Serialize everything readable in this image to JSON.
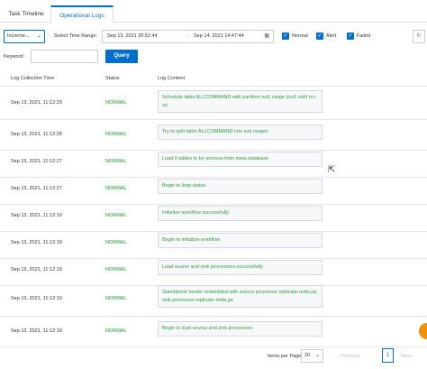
{
  "tabs": [
    {
      "label": "Task Timeline"
    },
    {
      "label": "Operational Logs"
    }
  ],
  "filters": {
    "level_select": "Increme...",
    "time_range_label": "Select Time Range:",
    "time_start": "Sep 13, 2021 20:52:44",
    "time_separator": "-",
    "time_end": "Sep 14, 2021 14:47:44",
    "checkboxes": [
      {
        "label": "Normal",
        "checked": true
      },
      {
        "label": "Alert",
        "checked": true
      },
      {
        "label": "Failed",
        "checked": true
      }
    ]
  },
  "search": {
    "keyword_label": "Keyword:",
    "keyword_value": "",
    "query_label": "Query"
  },
  "table": {
    "headers": [
      "Log Collection Time",
      "Status",
      "Log Content"
    ],
    "rows": [
      {
        "time": "Sep 13, 2021, 11:12:29",
        "status": "NORMAL",
        "content": "Schedule table ALLCOMMAND with partition null, range (null, null) to r un"
      },
      {
        "time": "Sep 13, 2021, 11:12:28",
        "status": "NORMAL",
        "content": "Try to split table ALLCOMMAND into sub ranges"
      },
      {
        "time": "Sep 13, 2021, 11:12:27",
        "status": "NORMAL",
        "content": "Load 0 tables to be process from meta database"
      },
      {
        "time": "Sep 13, 2021, 11:12:27",
        "status": "NORMAL",
        "content": "Begin to loop status"
      },
      {
        "time": "Sep 13, 2021, 11:12:19",
        "status": "NORMAL",
        "content": "Initialize workflow successfully"
      },
      {
        "time": "Sep 13, 2021, 11:12:19",
        "status": "NORMAL",
        "content": "Begin to initialize workflow"
      },
      {
        "time": "Sep 13, 2021, 11:12:19",
        "status": "NORMAL",
        "content": "Load source and sink processors successfully"
      },
      {
        "time": "Sep 13, 2021, 11:12:19",
        "status": "NORMAL",
        "content": "Standalone herder embedded with source processor replicate-redis.jar, sink processor replicate-redis.jar"
      },
      {
        "time": "Sep 13, 2021, 11:12:19",
        "status": "NORMAL",
        "content": "Begin to load source and sink processors"
      }
    ]
  },
  "pagination": {
    "items_per_page_label": "Items per Page",
    "items_per_page_value": "20",
    "prev_label": "Previous",
    "current_page": "1",
    "next_label": "Next"
  },
  "colors": {
    "accent": "#0070cc",
    "status_normal": "#1a9b2c",
    "help_button": "#f29100"
  },
  "icons": {
    "select_chevron": "chevron-down-icon",
    "calendar": "calendar-icon",
    "checkbox": "check-icon",
    "refresh": "refresh-icon",
    "cursor": "mouse-pointer-icon",
    "prev": "chevron-left-icon",
    "next": "chevron-right-icon"
  }
}
